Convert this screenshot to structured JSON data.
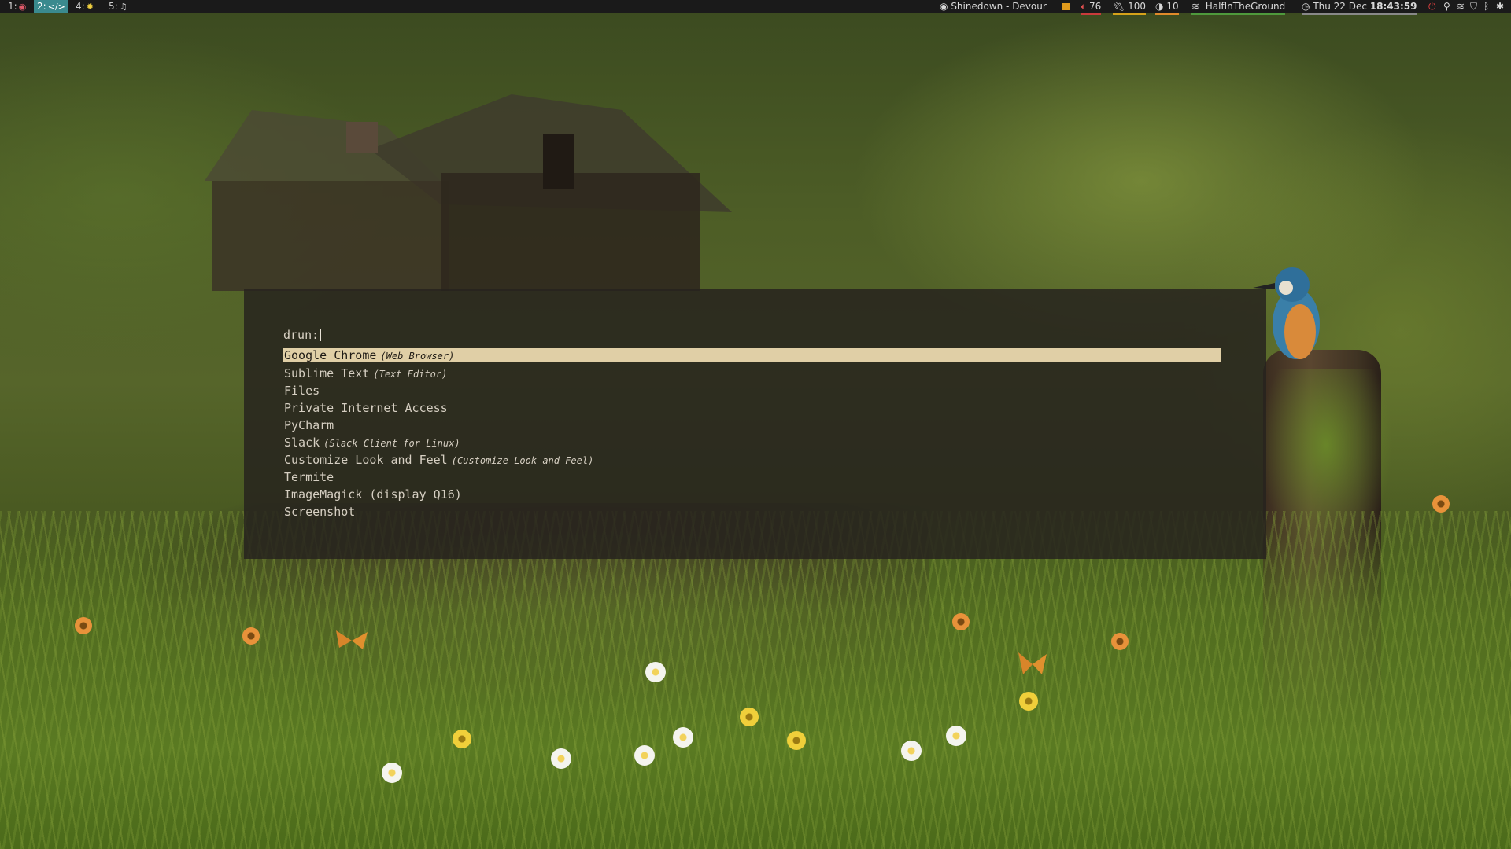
{
  "workspaces": [
    {
      "label": "1:",
      "icon": "ubuntu-icon",
      "glyph": "◉",
      "active": false
    },
    {
      "label": "2:",
      "icon": "code-icon",
      "glyph": "</>",
      "active": true
    },
    {
      "label": "4:",
      "icon": "settings-icon",
      "glyph": "✹",
      "active": false
    },
    {
      "label": "5:",
      "icon": "music-icon",
      "glyph": "♫",
      "active": false
    }
  ],
  "statusbar": {
    "now_playing": "Shinedown - Devour",
    "volume": "76",
    "battery": "100",
    "brightness": "10",
    "wifi": "HalfInTheGround",
    "date": "Thu 22 Dec",
    "time": "18:43:59"
  },
  "launcher": {
    "prompt": "drun:",
    "query": "",
    "entries": [
      {
        "name": "Google Chrome",
        "desc": "(Web Browser)",
        "selected": true
      },
      {
        "name": "Sublime Text",
        "desc": "(Text Editor)",
        "selected": false
      },
      {
        "name": "Files",
        "desc": "",
        "selected": false
      },
      {
        "name": "Private Internet Access",
        "desc": "",
        "selected": false
      },
      {
        "name": "PyCharm",
        "desc": "",
        "selected": false
      },
      {
        "name": "Slack",
        "desc": "(Slack Client for Linux)",
        "selected": false
      },
      {
        "name": "Customize Look and Feel",
        "desc": "(Customize Look and Feel)",
        "selected": false
      },
      {
        "name": "Termite",
        "desc": "",
        "selected": false
      },
      {
        "name": "ImageMagick (display Q16)",
        "desc": "",
        "selected": false
      },
      {
        "name": "Screenshot",
        "desc": "",
        "selected": false
      }
    ]
  },
  "colors": {
    "bar_bg": "#1a1a1a",
    "active_ws": "#3a8a8e",
    "launcher_bg": "rgba(38,34,30,0.84)",
    "selection": "#e0cfa6"
  }
}
